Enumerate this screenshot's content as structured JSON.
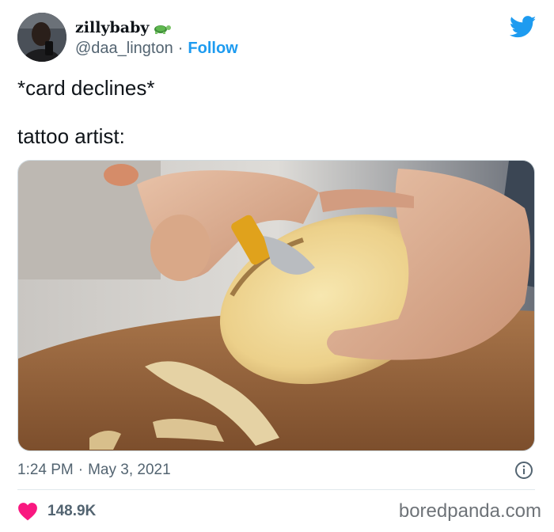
{
  "author": {
    "display_name": "zillybaby",
    "emoji_icon": "turtle-icon",
    "handle": "@daa_lington",
    "separator": "·",
    "follow_label": "Follow"
  },
  "tweet": {
    "line1": "*card declines*",
    "line2": "tattoo artist:"
  },
  "meta": {
    "time": "1:24 PM",
    "separator": "·",
    "date": "May 3, 2021"
  },
  "engagement": {
    "likes": "148.9K"
  },
  "watermark": "boredpanda.com",
  "colors": {
    "accent": "#1d9bf0",
    "heart": "#f91880",
    "muted": "#536471"
  }
}
